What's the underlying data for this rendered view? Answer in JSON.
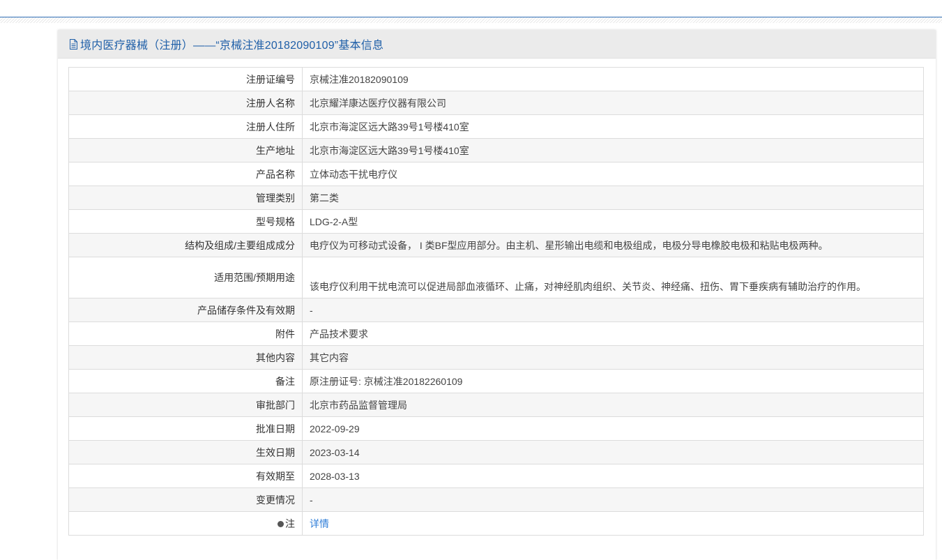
{
  "panel": {
    "title": "境内医疗器械（注册）——“京械注准20182090109”基本信息",
    "icon": "document-icon"
  },
  "rows": [
    {
      "label": "注册证编号",
      "value": "京械注准20182090109"
    },
    {
      "label": "注册人名称",
      "value": "北京耀洋康达医疗仪器有限公司"
    },
    {
      "label": "注册人住所",
      "value": "北京市海淀区远大路39号1号楼410室"
    },
    {
      "label": "生产地址",
      "value": "北京市海淀区远大路39号1号楼410室"
    },
    {
      "label": "产品名称",
      "value": "立体动态干扰电疗仪"
    },
    {
      "label": "管理类别",
      "value": "第二类"
    },
    {
      "label": "型号规格",
      "value": "LDG-2-A型"
    },
    {
      "label": "结构及组成/主要组成成分",
      "value": "电疗仪为可移动式设备， I 类BF型应用部分。由主机、星形输出电缆和电极组成，电极分导电橡胶电极和粘贴电极两种。"
    },
    {
      "label": "适用范围/预期用途",
      "value": "该电疗仪利用干扰电流可以促进局部血液循环、止痛，对神经肌肉组织、关节炎、神经痛、扭伤、胃下垂疾病有辅助治疗的作用。"
    },
    {
      "label": "产品储存条件及有效期",
      "value": "-"
    },
    {
      "label": "附件",
      "value": "产品技术要求"
    },
    {
      "label": "其他内容",
      "value": "其它内容"
    },
    {
      "label": "备注",
      "value": "原注册证号: 京械注准20182260109"
    },
    {
      "label": "审批部门",
      "value": "北京市药品监督管理局"
    },
    {
      "label": "批准日期",
      "value": "2022-09-29"
    },
    {
      "label": "生效日期",
      "value": "2023-03-14"
    },
    {
      "label": "有效期至",
      "value": "2028-03-13"
    },
    {
      "label": "变更情况",
      "value": "-"
    },
    {
      "label": "注",
      "value": "详情"
    }
  ],
  "colors": {
    "title": "#1f5fa8",
    "link": "#2f7ed8",
    "top_line": "#2f6db5"
  }
}
